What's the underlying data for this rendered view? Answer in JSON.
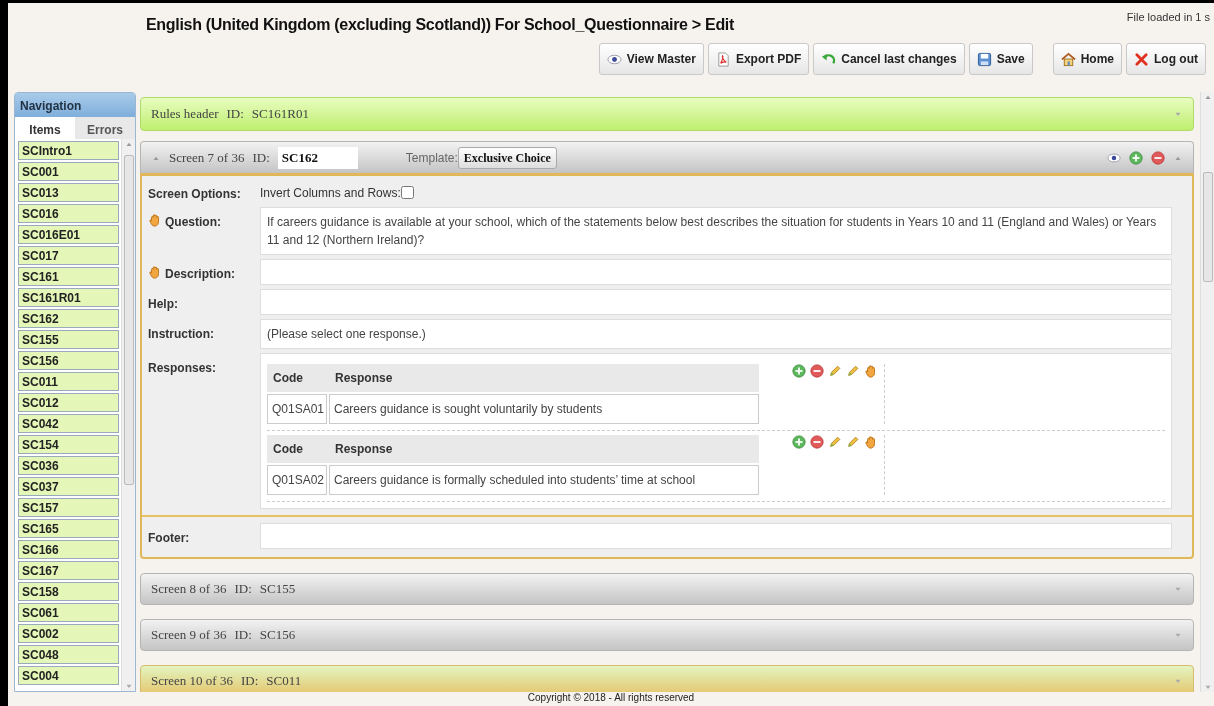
{
  "header": {
    "title": "English (United Kingdom (excluding Scotland)) For School_Questionnaire > Edit",
    "status": "File loaded in 1 s",
    "toolbar": [
      {
        "kind": "view",
        "label": "View Master"
      },
      {
        "kind": "pdf",
        "label": "Export PDF"
      },
      {
        "kind": "undo",
        "label": "Cancel last changes"
      },
      {
        "kind": "save",
        "label": "Save"
      },
      {
        "kind": "home",
        "label": "Home"
      },
      {
        "kind": "logout",
        "label": "Log out"
      }
    ]
  },
  "navigation": {
    "title": "Navigation",
    "tabs": [
      {
        "label": "Items",
        "selected": true
      },
      {
        "label": "Errors",
        "selected": false
      }
    ],
    "items": [
      {
        "label": "SCIntro1"
      },
      {
        "label": "SC001"
      },
      {
        "label": "SC013"
      },
      {
        "label": "SC016"
      },
      {
        "label": "SC016E01"
      },
      {
        "label": "SC017"
      },
      {
        "label": "SC161"
      },
      {
        "label": "SC161R01"
      },
      {
        "label": "SC162"
      },
      {
        "label": "SC155"
      },
      {
        "label": "SC156"
      },
      {
        "label": "SC011"
      },
      {
        "label": "SC012"
      },
      {
        "label": "SC042"
      },
      {
        "label": "SC154"
      },
      {
        "label": "SC036"
      },
      {
        "label": "SC037"
      },
      {
        "label": "SC157"
      },
      {
        "label": "SC165"
      },
      {
        "label": "SC166"
      },
      {
        "label": "SC167"
      },
      {
        "label": "SC158"
      },
      {
        "label": "SC061"
      },
      {
        "label": "SC002"
      },
      {
        "label": "SC048"
      },
      {
        "label": "SC004"
      }
    ]
  },
  "sections": [
    {
      "kind": "rules",
      "title": "Rules header",
      "id_label": "ID:",
      "id": "SC161R01",
      "expanded": false,
      "highlighted": false
    },
    {
      "kind": "screen",
      "title": "Screen 7 of 36",
      "id_label": "ID:",
      "id": "SC162",
      "expanded": true,
      "highlighted": false,
      "template_label": "Template:",
      "template": "Exclusive Choice",
      "fields": [
        {
          "kind": "options",
          "label": "Screen Options:",
          "marked": false,
          "option_label": "Invert Columns and Rows:",
          "checked": false
        },
        {
          "kind": "text",
          "label": "Question:",
          "marked": true,
          "value": "If careers guidance is available at your school, which of the statements below best describes the situation for students in Years 10 and 11 (England and Wales) or Years 11 and 12 (Northern Ireland)?"
        },
        {
          "kind": "text",
          "label": "Description:",
          "marked": true
        },
        {
          "kind": "text",
          "label": "Help:",
          "marked": false
        },
        {
          "kind": "text",
          "label": "Instruction:",
          "marked": false,
          "value": "(Please select one response.)"
        },
        {
          "kind": "responses",
          "label": "Responses:",
          "marked": false,
          "items": [
            {
              "code_heading": "Code",
              "response_heading": "Response",
              "code": "Q01SA01",
              "text": "Careers guidance is sought voluntarily by students"
            },
            {
              "code_heading": "Code",
              "response_heading": "Response",
              "code": "Q01SA02",
              "text": "Careers guidance is formally scheduled into students’ time at school"
            }
          ]
        },
        {
          "kind": "footer",
          "label": "Footer:",
          "marked": false
        }
      ]
    },
    {
      "kind": "screen",
      "title": "Screen 8 of 36",
      "id_label": "ID:",
      "id": "SC155",
      "expanded": false,
      "highlighted": false
    },
    {
      "kind": "screen",
      "title": "Screen 9 of 36",
      "id_label": "ID:",
      "id": "SC156",
      "expanded": false,
      "highlighted": false
    },
    {
      "kind": "screen",
      "title": "Screen 10 of 36",
      "id_label": "ID:",
      "id": "SC011",
      "expanded": false,
      "highlighted": true
    }
  ],
  "copyright": "Copyright © 2018 - All rights reserved"
}
